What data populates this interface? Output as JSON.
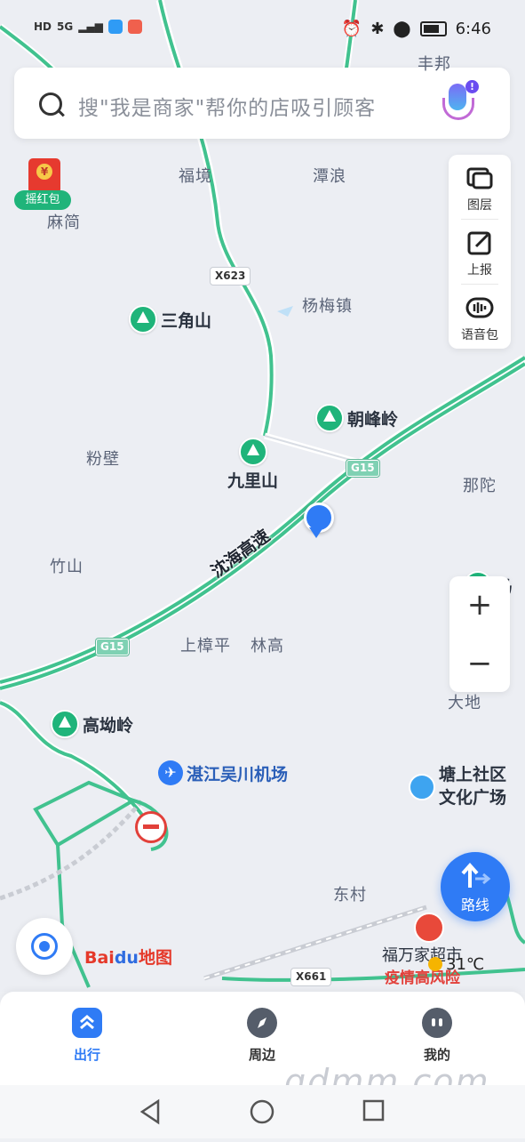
{
  "status_bar": {
    "left_badges": [
      "HD",
      "5G"
    ],
    "time": "6:46"
  },
  "search": {
    "placeholder": "搜\"我是商家\"帮你的店吸引顾客"
  },
  "red_packet": {
    "label": "摇红包"
  },
  "tools": [
    {
      "label": "图层",
      "icon": "layers-icon"
    },
    {
      "label": "上报",
      "icon": "report-icon"
    },
    {
      "label": "语音包",
      "icon": "voice-pack-icon"
    }
  ],
  "map": {
    "places": {
      "fengjing": "福境",
      "tanlang": "潭浪",
      "majian": "麻简",
      "yangmei": "杨梅镇",
      "fenbi": "粉壁",
      "natuo": "那陀",
      "zhushan": "竹山",
      "shangzhangping": "上樟平",
      "lingao": "林高",
      "dadi": "大地",
      "dongcun": "东村",
      "top_partial": "丰邦"
    },
    "mountains": {
      "sanjiao": "三角山",
      "chaofeng": "朝峰岭",
      "jiuli": "九里山",
      "gaoao": "高坳岭",
      "ma_partial": "马"
    },
    "road_name": "沈海高速",
    "shields": {
      "g15_a": "G15",
      "g15_b": "G15",
      "x623": "X623",
      "x661": "X661"
    },
    "airport": "湛江吴川机场",
    "plaza": [
      "塘上社区",
      "文化广场"
    ],
    "supermarket": "福万家超市",
    "risk_label": "疫情高风险"
  },
  "zoom": {
    "in": "+",
    "out": "−"
  },
  "route_button": "路线",
  "logo": {
    "bai": "Bai",
    "du": "du",
    "map": "地图"
  },
  "weather": "31℃",
  "nav": [
    {
      "label": "出行",
      "active": true
    },
    {
      "label": "周边",
      "active": false
    },
    {
      "label": "我的",
      "active": false
    }
  ],
  "watermark": "gdmm.com"
}
